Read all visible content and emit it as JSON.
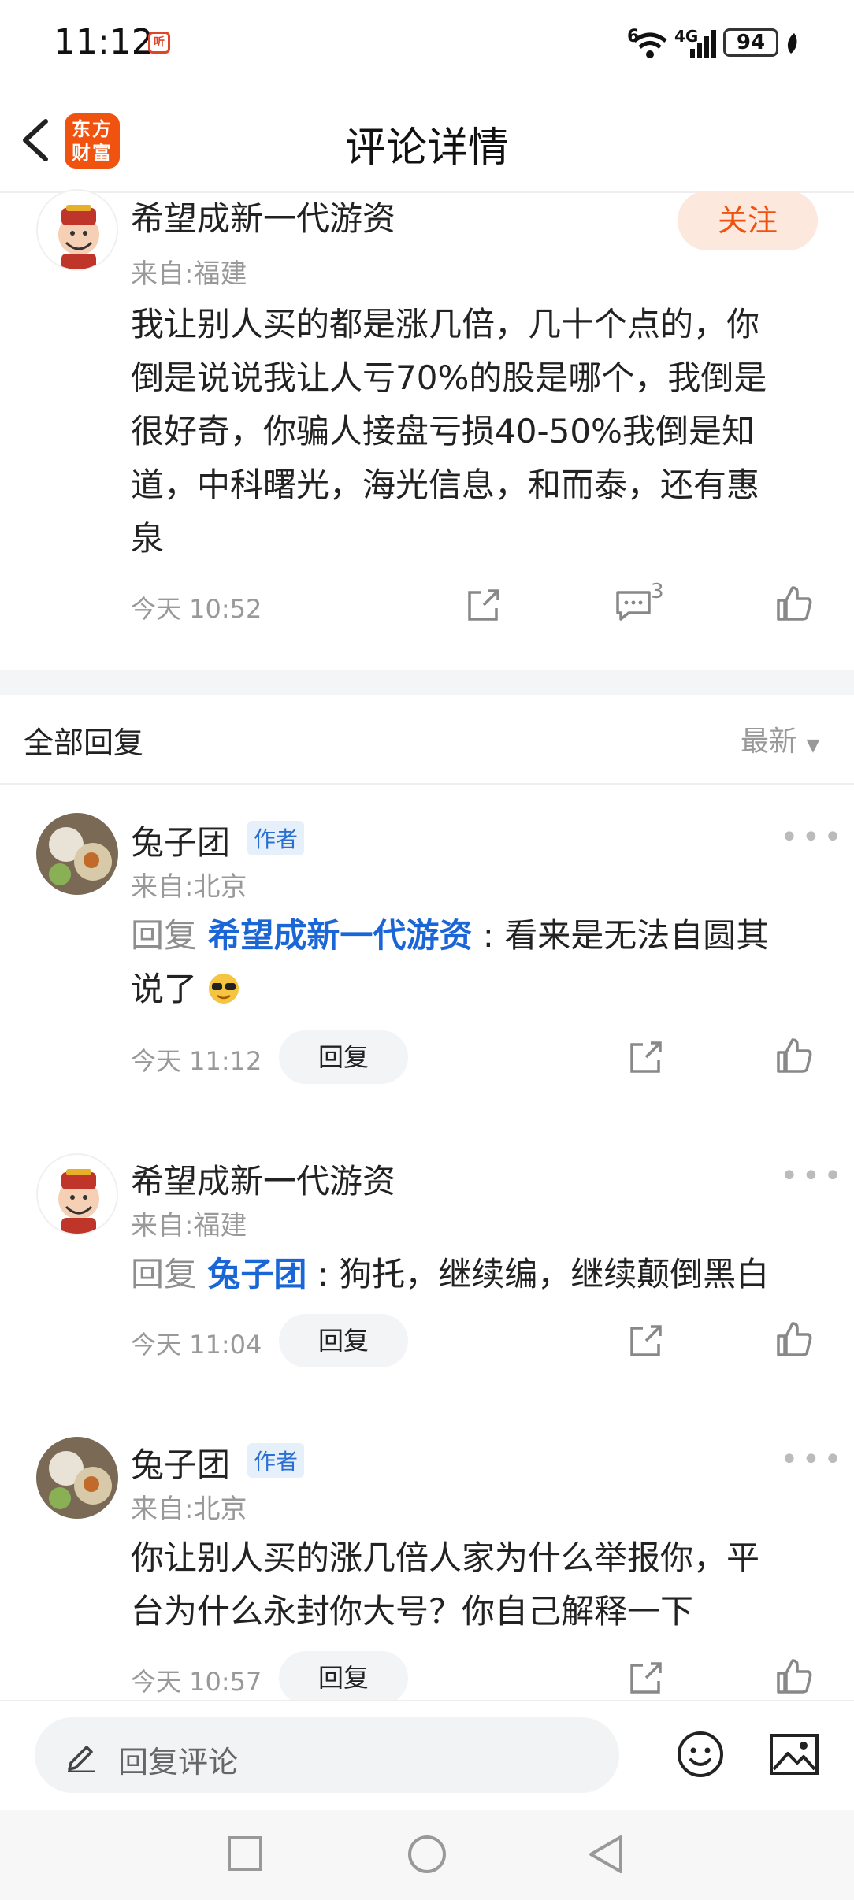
{
  "status": {
    "time": "11:12",
    "mini_badge": "听",
    "signal_label": "4G",
    "wifi_label": "6",
    "battery": "94"
  },
  "header": {
    "logo_line1": "东方",
    "logo_line2": "财富",
    "title": "评论详情"
  },
  "main_comment": {
    "user": "希望成新一代游资",
    "location": "来自:福建",
    "follow_label": "关注",
    "lines": [
      "我让别人买的都是涨几倍，几十个点的，你",
      "倒是说说我让人亏70%的股是哪个，我倒是",
      "很好奇，你骗人接盘亏损40-50%我倒是知",
      "道，中科曙光，海光信息，和而泰，还有惠",
      "泉"
    ],
    "time": "今天 10:52",
    "comment_count": "3"
  },
  "replies_header": {
    "title": "全部回复",
    "sort": "最新"
  },
  "replies": [
    {
      "user": "兔子团",
      "tag": "作者",
      "location": "来自:北京",
      "prefix": "回复 ",
      "mention": "希望成新一代游资",
      "line1": " : 看来是无法自圆其",
      "line2": "说了",
      "time": "今天 11:12",
      "reply_label": "回复"
    },
    {
      "user": "希望成新一代游资",
      "location": "来自:福建",
      "prefix": "回复 ",
      "mention": "兔子团",
      "line1": " : 狗托，继续编，继续颠倒黑白",
      "time": "今天 11:04",
      "reply_label": "回复"
    },
    {
      "user": "兔子团",
      "tag": "作者",
      "location": "来自:北京",
      "line1": "你让别人买的涨几倍人家为什么举报你，平",
      "line2": "台为什么永封你大号？你自己解释一下",
      "time": "今天 10:57",
      "reply_label": "回复"
    }
  ],
  "input": {
    "placeholder": "回复评论"
  },
  "icons": {
    "share": "share-icon",
    "comment": "comment-icon",
    "like": "thumbs-up-icon",
    "more": "more-icon",
    "emoji": "emoji-icon",
    "image": "image-icon",
    "edit": "pencil-icon"
  },
  "colors": {
    "brand": "#f0520f",
    "mention": "#1a66d6",
    "author_tag_bg": "#e6f0fb"
  }
}
